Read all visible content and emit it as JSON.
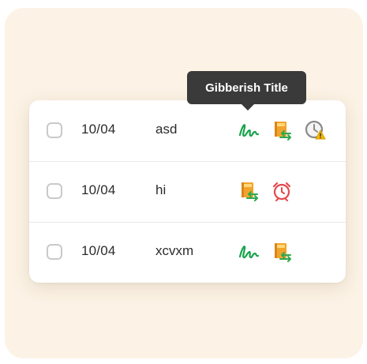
{
  "tooltip": {
    "text": "Gibberish Title"
  },
  "rows": [
    {
      "date": "10/04",
      "title": "asd",
      "icons": [
        "signature-icon",
        "book-exchange-icon",
        "clock-warning-icon"
      ]
    },
    {
      "date": "10/04",
      "title": "hi",
      "icons": [
        "book-exchange-icon",
        "alarm-clock-icon"
      ]
    },
    {
      "date": "10/04",
      "title": "xcvxm",
      "icons": [
        "signature-icon",
        "book-exchange-icon"
      ]
    }
  ],
  "colors": {
    "background": "#fcf3e6",
    "card": "#ffffff",
    "tooltip": "#3a3a3a",
    "signature_green": "#17a34a",
    "book_orange": "#f2a32c",
    "arrow_green": "#2fa84f",
    "alarm_red": "#e5484d"
  }
}
